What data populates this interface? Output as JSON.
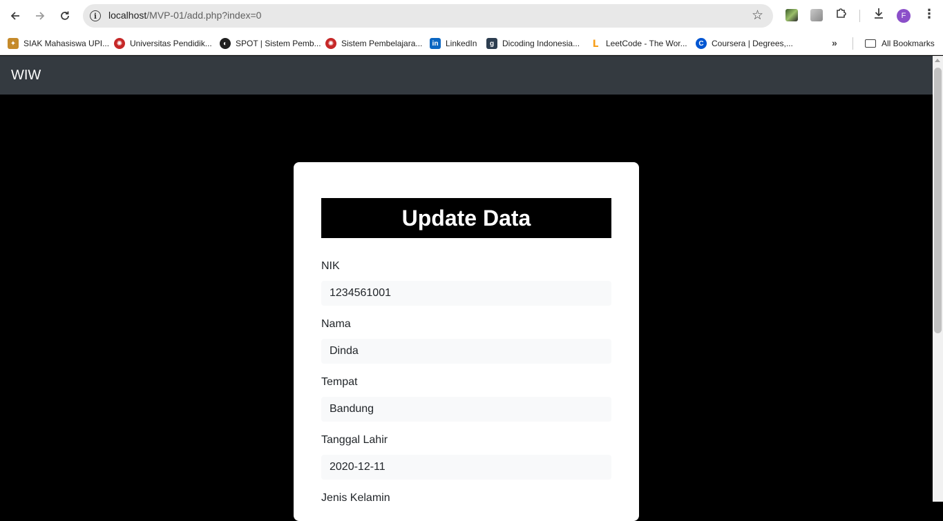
{
  "browser": {
    "url_host": "localhost",
    "url_path": "/MVP-01/add.php?index=0",
    "profile_initial": "F",
    "all_bookmarks_label": "All Bookmarks"
  },
  "bookmarks": [
    {
      "label": "SIAK Mahasiswa UPI...",
      "icon": "siak-icon",
      "color": "#c58a2a"
    },
    {
      "label": "Universitas Pendidik...",
      "icon": "upi-icon",
      "color": "#c62828"
    },
    {
      "label": "SPOT | Sistem Pemb...",
      "icon": "globe-icon",
      "color": "#202020"
    },
    {
      "label": "Sistem Pembelajara...",
      "icon": "upi-icon",
      "color": "#c62828"
    },
    {
      "label": "LinkedIn",
      "icon": "linkedin-icon",
      "color": "#0a66c2"
    },
    {
      "label": "Dicoding Indonesia...",
      "icon": "dicoding-icon",
      "color": "#2d3e50"
    },
    {
      "label": "LeetCode - The Wor...",
      "icon": "leetcode-icon",
      "color": "#f89f1b"
    },
    {
      "label": "Coursera | Degrees,...",
      "icon": "coursera-icon",
      "color": "#0056d2"
    }
  ],
  "navbar": {
    "brand": "WIW"
  },
  "form": {
    "title": "Update Data",
    "fields": [
      {
        "label": "NIK",
        "value": "1234561001"
      },
      {
        "label": "Nama",
        "value": "Dinda"
      },
      {
        "label": "Tempat",
        "value": "Bandung"
      },
      {
        "label": "Tanggal Lahir",
        "value": "2020-12-11"
      },
      {
        "label": "Jenis Kelamin",
        "value": ""
      }
    ]
  }
}
